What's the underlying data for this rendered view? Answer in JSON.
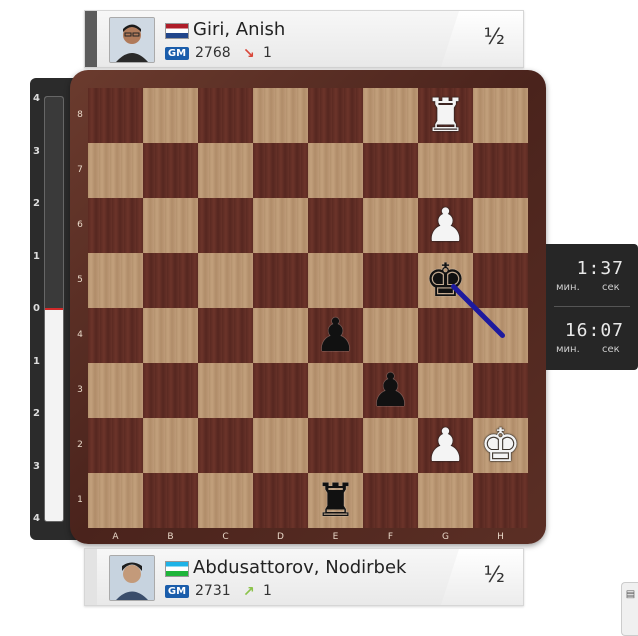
{
  "top_player": {
    "name": "Giri, Anish",
    "title": "GM",
    "rating": "2768",
    "rating_change": "1",
    "trend": "down",
    "trend_color": "#d9473a",
    "score": "½",
    "flag_colors": [
      "#ae1c28",
      "#ffffff",
      "#21468b"
    ]
  },
  "bottom_player": {
    "name": "Abdusattorov, Nodirbek",
    "title": "GM",
    "rating": "2731",
    "rating_change": "1",
    "trend": "up",
    "trend_color": "#8bc34a",
    "score": "½",
    "flag_colors": [
      "#1eb3e7",
      "#ffffff",
      "#1eb53a"
    ]
  },
  "eval_bar": {
    "ticks_top": [
      "4",
      "3",
      "2",
      "1",
      "0"
    ],
    "ticks_bottom": [
      "1",
      "2",
      "3",
      "4"
    ],
    "evaluation": 0
  },
  "board": {
    "files": [
      "A",
      "B",
      "C",
      "D",
      "E",
      "F",
      "G",
      "H"
    ],
    "ranks": [
      "8",
      "7",
      "6",
      "5",
      "4",
      "3",
      "2",
      "1"
    ],
    "pieces": [
      {
        "square": "g8",
        "type": "rook",
        "color": "white"
      },
      {
        "square": "g6",
        "type": "pawn",
        "color": "white"
      },
      {
        "square": "g5",
        "type": "king",
        "color": "black"
      },
      {
        "square": "e4",
        "type": "pawn",
        "color": "black"
      },
      {
        "square": "f3",
        "type": "pawn",
        "color": "black"
      },
      {
        "square": "g2",
        "type": "pawn",
        "color": "white"
      },
      {
        "square": "h2",
        "type": "king",
        "color": "white"
      },
      {
        "square": "e1",
        "type": "rook",
        "color": "black"
      }
    ],
    "arrows": [
      {
        "from": "g5",
        "to": "h4",
        "color": "#1d1a9e"
      }
    ]
  },
  "clock": {
    "top_time": "1:37",
    "bottom_time": "16:07",
    "min_label": "мин.",
    "sec_label": "сек"
  }
}
